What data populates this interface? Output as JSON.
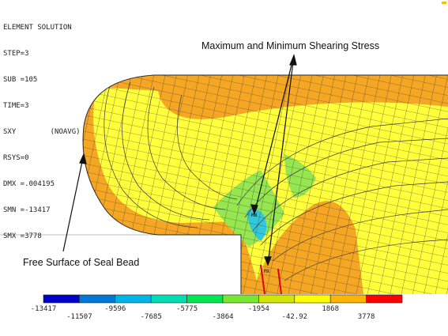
{
  "solution_info": {
    "title": "ELEMENT SOLUTION",
    "lines": [
      "STEP=3",
      "SUB =105",
      "TIME=3",
      "SXY        (NOAVG)",
      "RSYS=0",
      "DMX =.004195",
      "SMN =-13417",
      "SMX =3778"
    ]
  },
  "annotations": {
    "max_min_label": "Maximum and Minimum Shearing Stress",
    "free_surface_label": "Free Surface of Seal Bead"
  },
  "markers": {
    "mn": "MN",
    "mx": "MX"
  },
  "legend": {
    "ticks": [
      "-13417",
      "-11507",
      "-9596",
      "-7685",
      "-5775",
      "-3864",
      "-1954",
      "-42.92",
      "1868",
      "3778"
    ],
    "colors": [
      "#0000c8",
      "#0078d8",
      "#00b4e6",
      "#00dcb4",
      "#00e650",
      "#78e632",
      "#d2e600",
      "#ffff00",
      "#ffb400",
      "#ff0000"
    ]
  },
  "mesh_colors": {
    "orange": "#f5a623",
    "yellow": "#ffff3c",
    "green": "#96e650",
    "cyan": "#32c8dc",
    "red": "#e60000",
    "edge": "#3a3a3a"
  }
}
